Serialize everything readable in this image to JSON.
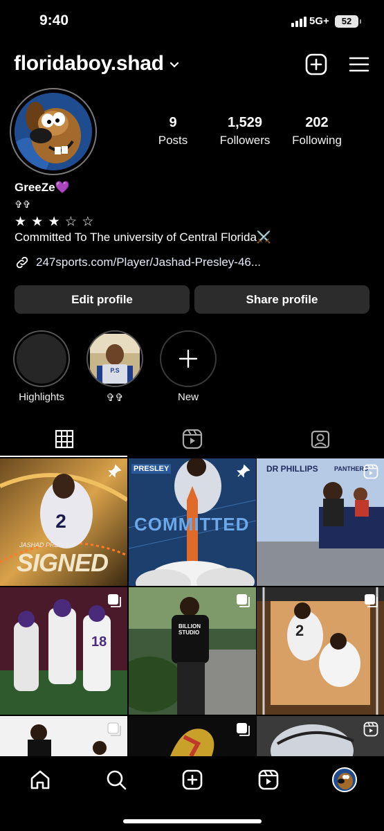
{
  "status_bar": {
    "time": "9:40",
    "network": "5G+",
    "battery": "52"
  },
  "header": {
    "username": "floridaboy.shad"
  },
  "stats": [
    {
      "value": "9",
      "label": "Posts"
    },
    {
      "value": "1,529",
      "label": "Followers"
    },
    {
      "value": "202",
      "label": "Following"
    }
  ],
  "bio": {
    "name": "GreeZe💜",
    "line1": "✞✞",
    "stars": "★ ★ ★ ☆ ☆",
    "line3": "Committed To The university of Central Florida⚔️",
    "link": "247sports.com/Player/Jashad-Presley-46..."
  },
  "buttons": {
    "edit": "Edit profile",
    "share": "Share profile"
  },
  "highlights": [
    {
      "label": "Highlights"
    },
    {
      "label": "✞✞"
    },
    {
      "label": "New"
    }
  ],
  "posts": [
    {
      "text": "SIGNED",
      "sub": "JASHAD PRESLEY",
      "badge": "pin-icon"
    },
    {
      "text": "COMMITTED",
      "sub": "PRESLEY",
      "badge": "pin-icon"
    },
    {
      "text": "DR PHILLIPS",
      "sub": "PANTHERS",
      "badge": "reel-icon"
    },
    {
      "text": "18",
      "sub": "",
      "badge": "carousel-icon"
    },
    {
      "text": "BILLION STUDIO",
      "sub": "",
      "badge": "carousel-icon"
    },
    {
      "text": "2",
      "sub": "",
      "badge": "carousel-icon"
    },
    {
      "text": "",
      "sub": "",
      "badge": "carousel-icon"
    },
    {
      "text": "",
      "sub": "",
      "badge": "carousel-icon"
    },
    {
      "text": "",
      "sub": "",
      "badge": "reel-icon"
    }
  ],
  "colors": {
    "background": "#000000",
    "button": "#2c2c2c",
    "link": "#e3e9f5"
  }
}
